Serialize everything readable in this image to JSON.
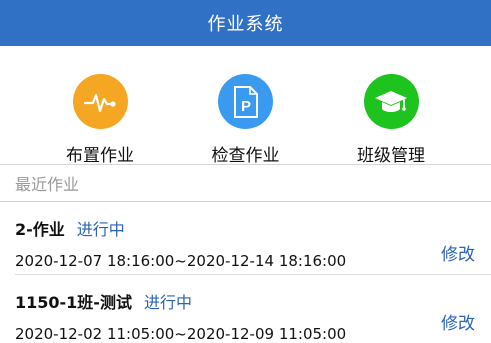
{
  "header": {
    "title": "作业系统"
  },
  "shortcuts": [
    {
      "label": "布置作业",
      "icon": "waveform-icon",
      "color": "#f5a623"
    },
    {
      "label": "检查作业",
      "icon": "document-p-icon",
      "color": "#3a9af0"
    },
    {
      "label": "班级管理",
      "icon": "graduation-cap-icon",
      "color": "#1ec31e"
    }
  ],
  "recent": {
    "heading": "最近作业",
    "items": [
      {
        "name": "2-作业",
        "status": "进行中",
        "period": "2020-12-07 18:16:00~2020-12-14 18:16:00",
        "action": "修改"
      },
      {
        "name": "1150-1班-测试",
        "status": "进行中",
        "period": "2020-12-02 11:05:00~2020-12-09 11:05:00",
        "action": "修改"
      }
    ]
  },
  "colors": {
    "nav_bg": "#3071c6",
    "link": "#2b64b4"
  }
}
